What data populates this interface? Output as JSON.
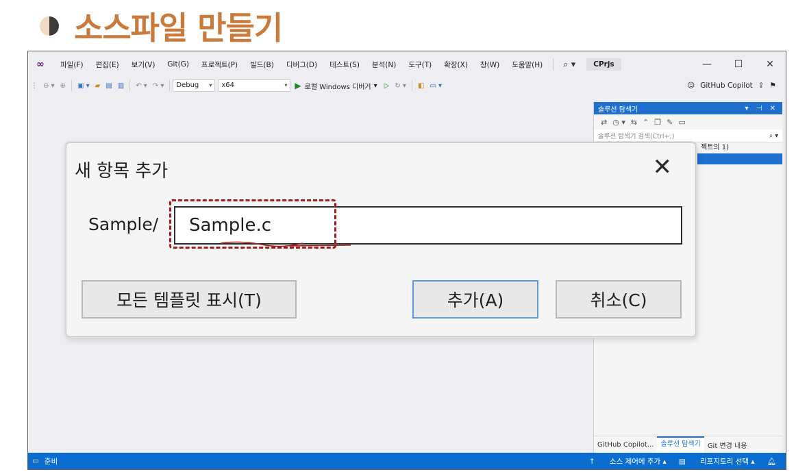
{
  "slide": {
    "title": "소스파일 만들기"
  },
  "menubar": {
    "items": [
      "파일(F)",
      "편집(E)",
      "보기(V)",
      "Git(G)",
      "프로젝트(P)",
      "빌드(B)",
      "디버그(D)",
      "테스트(S)",
      "분석(N)",
      "도구(T)",
      "확장(X)",
      "창(W)",
      "도움말(H)"
    ],
    "solution_name": "CPrjs"
  },
  "toolbar": {
    "config": "Debug",
    "platform": "x64",
    "run_label": "로컬 Windows 디버거",
    "copilot_label": "GitHub Copilot"
  },
  "solution_explorer": {
    "title": "솔루션 탐색기",
    "search_placeholder": "솔루션 탐색기 검색(Ctrl+;)",
    "tree_row": "젝트의 1)",
    "tabs": [
      "GitHub Copilot...",
      "솔루션 탐색기",
      "Git 변경 내용"
    ]
  },
  "statusbar": {
    "ready": "준비",
    "source_control": "소스 제어에 추가",
    "repo_select": "리포지토리 선택"
  },
  "dialog": {
    "title": "새 항목 추가",
    "path_label": "Sample/",
    "name_value": "Sample.c",
    "show_templates_button": "모든 템플릿 표시(T)",
    "add_button": "추가(A)",
    "cancel_button": "취소(C)"
  },
  "colors": {
    "title_accent": "#c87b3c",
    "vs_blue": "#0a6dcf",
    "annotation_red": "#a51b1b"
  }
}
